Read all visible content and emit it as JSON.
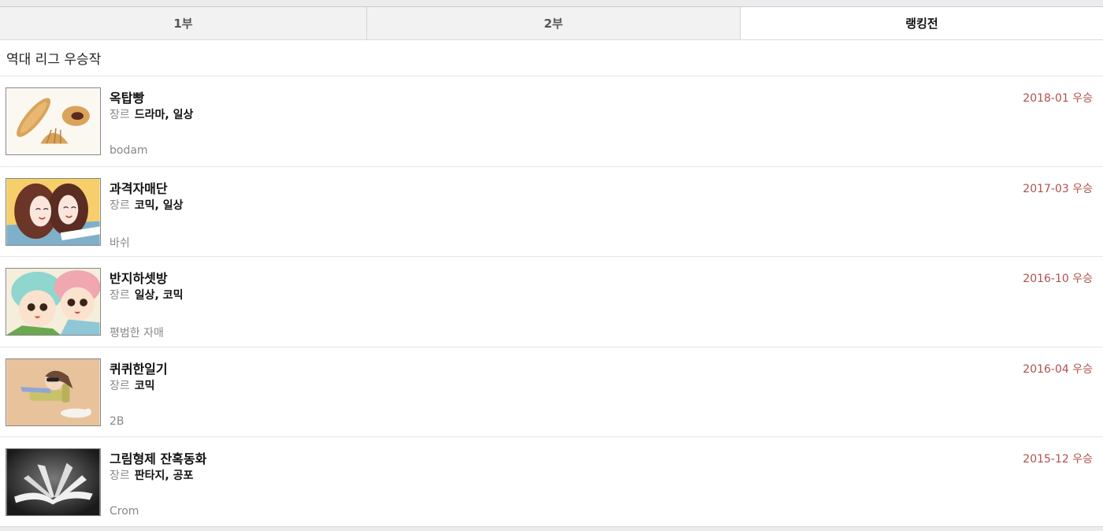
{
  "tabs": [
    {
      "label": "1부",
      "active": false
    },
    {
      "label": "2부",
      "active": false
    },
    {
      "label": "랭킹전",
      "active": true
    }
  ],
  "section": {
    "title": "역대 리그 우승작"
  },
  "genre_label": "장르",
  "items": [
    {
      "title": "옥탑빵",
      "genre": "드라마, 일상",
      "author": "bodam",
      "date": "2018-01 우승",
      "thumb_icon": "bread-thumbnail"
    },
    {
      "title": "과격자매단",
      "genre": "코믹, 일상",
      "author": "바쉬",
      "date": "2017-03 우승",
      "thumb_icon": "sisters-thumbnail"
    },
    {
      "title": "반지하셋방",
      "genre": "일상, 코믹",
      "author": "평범한 자매",
      "date": "2016-10 우승",
      "thumb_icon": "kids-thumbnail"
    },
    {
      "title": "퀴퀴한일기",
      "genre": "코믹",
      "author": "2B",
      "date": "2016-04 우승",
      "thumb_icon": "sofa-thumbnail"
    },
    {
      "title": "그림형제 잔혹동화",
      "genre": "판타지, 공포",
      "author": "Crom",
      "date": "2015-12 우승",
      "thumb_icon": "book-thumbnail"
    }
  ],
  "colors": {
    "accent_date": "#b0504d",
    "active_tab_bg": "#ffffff",
    "inactive_tab_bg": "#f2f2f2"
  }
}
